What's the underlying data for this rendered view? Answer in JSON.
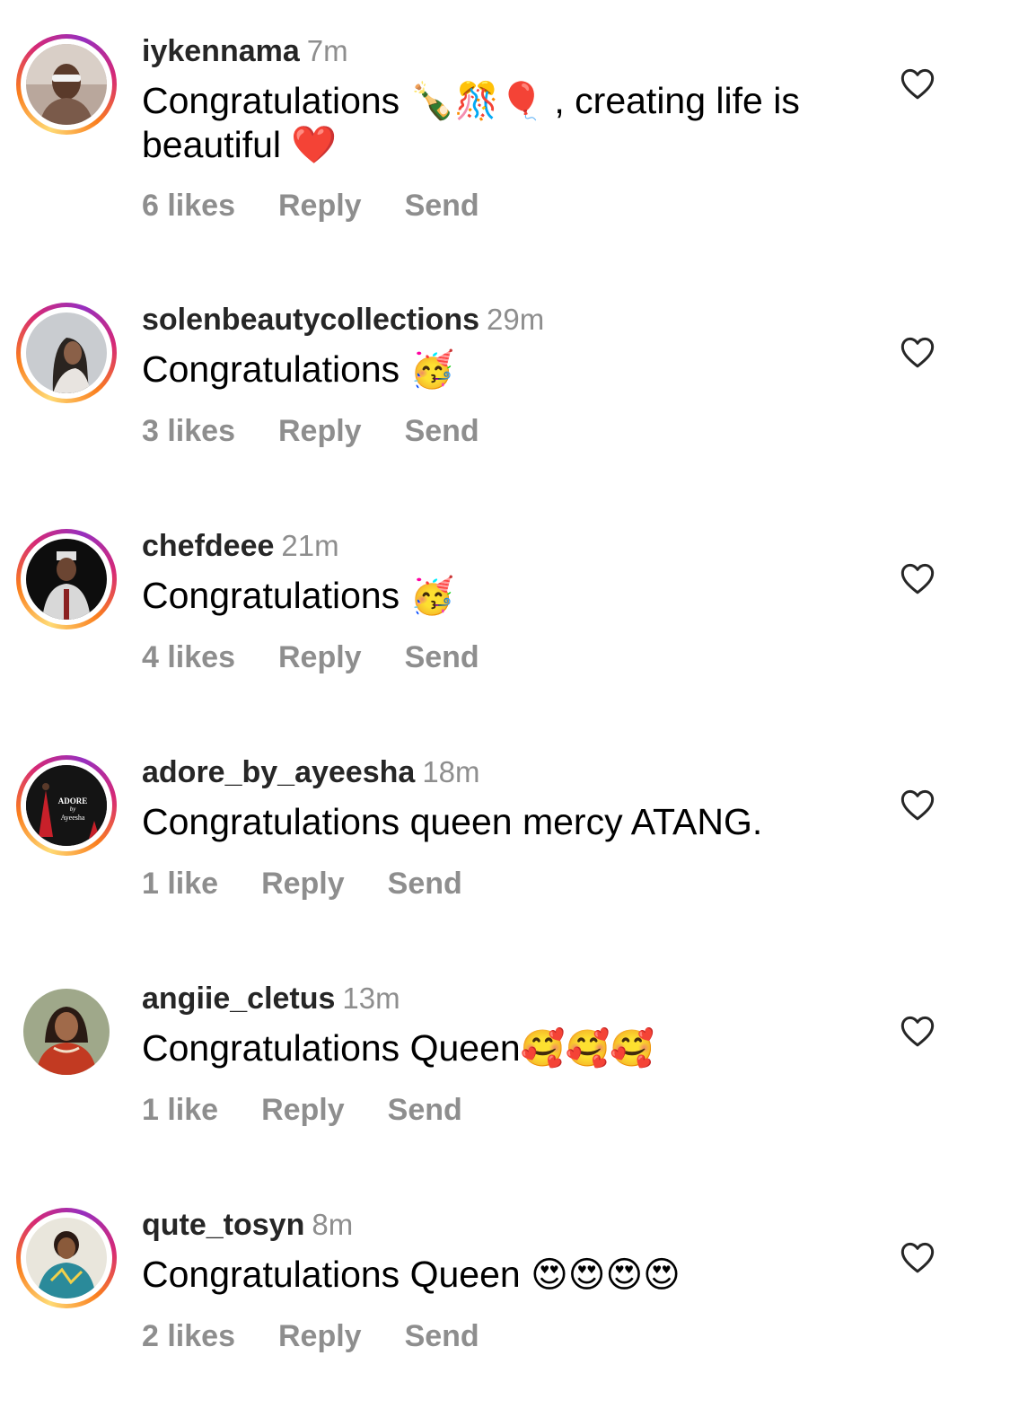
{
  "comments": [
    {
      "username": "iykennama",
      "time": "7m",
      "text_before": "Congratulations ",
      "emojis": "🍾🎊🎈",
      "text_after": " , creating life is beautiful ❤️",
      "likes": "6 likes",
      "reply": "Reply",
      "send": "Send"
    },
    {
      "username": "solenbeautycollections",
      "time": "29m",
      "text_before": "Congratulations ",
      "emojis": "🥳",
      "text_after": "",
      "likes": "3 likes",
      "reply": "Reply",
      "send": "Send"
    },
    {
      "username": "chefdeee",
      "time": "21m",
      "text_before": "Congratulations ",
      "emojis": "🥳",
      "text_after": "",
      "likes": "4 likes",
      "reply": "Reply",
      "send": "Send"
    },
    {
      "username": "adore_by_ayeesha",
      "time": "18m",
      "text_before": "Congratulations queen mercy ATANG.",
      "emojis": "",
      "text_after": "",
      "likes": "1 like",
      "reply": "Reply",
      "send": "Send",
      "avatar_text": "ADORE",
      "avatar_text2": "by",
      "avatar_text3": "Ayeesha"
    },
    {
      "username": "angiie_cletus",
      "time": "13m",
      "text_before": "Congratulations Queen",
      "emojis": "🥰🥰🥰",
      "text_after": "",
      "likes": "1 like",
      "reply": "Reply",
      "send": "Send"
    },
    {
      "username": "qute_tosyn",
      "time": "8m",
      "text_before": "Congratulations Queen ",
      "emojis": "😍😍😍😍",
      "text_after": "",
      "likes": "2 likes",
      "reply": "Reply",
      "send": "Send"
    }
  ],
  "colors": {
    "text": "#000000",
    "username": "#262626",
    "secondary": "#8e8e8e",
    "story_ring": [
      "#feda75",
      "#fa7e1e",
      "#d62976",
      "#962fbf"
    ]
  }
}
